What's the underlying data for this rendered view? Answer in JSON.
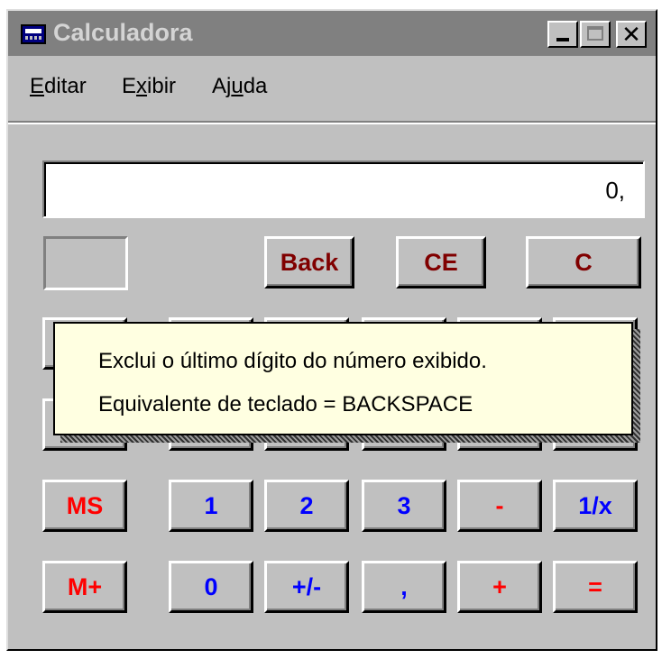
{
  "window": {
    "title": "Calculadora"
  },
  "menu": [
    {
      "pre": "",
      "u": "E",
      "post": "ditar"
    },
    {
      "pre": "E",
      "u": "x",
      "post": "ibir"
    },
    {
      "pre": "Aj",
      "u": "u",
      "post": "da"
    }
  ],
  "display": {
    "value": "0,"
  },
  "keys": {
    "back": "Back",
    "ce": "CE",
    "c": "C",
    "ms": "MS",
    "mplus": "M+",
    "k1": "1",
    "k2": "2",
    "k3": "3",
    "minus": "-",
    "recip": "1/x",
    "k0": "0",
    "sign": "+/-",
    "comma": ",",
    "plus": "+",
    "equals": "="
  },
  "tooltip": {
    "line1": "Exclui o último dígito do número exibido.",
    "line2": "Equivalente de teclado = BACKSPACE"
  }
}
